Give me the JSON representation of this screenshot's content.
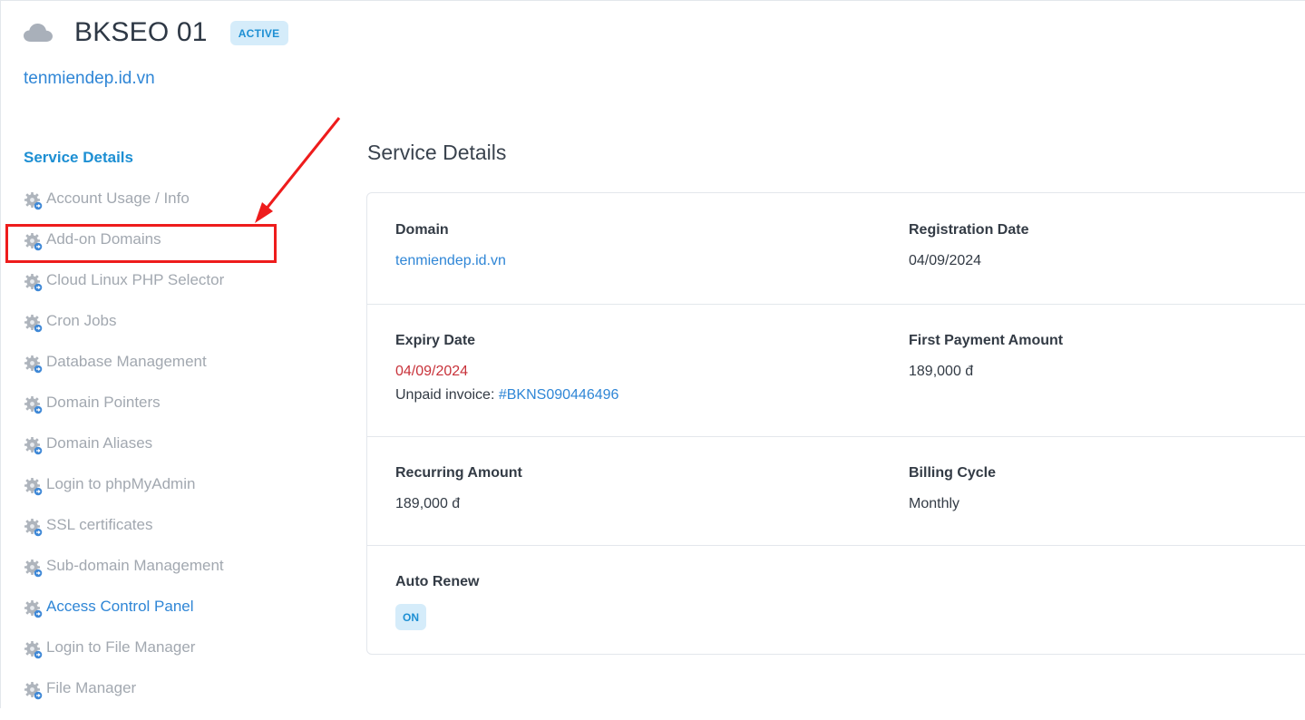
{
  "header": {
    "icon": "cloud-icon",
    "service_name": "BKSEO 01",
    "status": "ACTIVE",
    "domain": "tenmiendep.id.vn"
  },
  "sidebar": {
    "heading": "Service Details",
    "item_icon": "gear-icon",
    "items": [
      {
        "label": "Account Usage / Info"
      },
      {
        "label": "Add-on Domains"
      },
      {
        "label": "Cloud Linux PHP Selector"
      },
      {
        "label": "Cron Jobs"
      },
      {
        "label": "Database Management"
      },
      {
        "label": "Domain Pointers"
      },
      {
        "label": "Domain Aliases"
      },
      {
        "label": "Login to phpMyAdmin"
      },
      {
        "label": "SSL certificates"
      },
      {
        "label": "Sub-domain Management"
      },
      {
        "label": "Access Control Panel"
      },
      {
        "label": "Login to File Manager"
      },
      {
        "label": "File Manager"
      }
    ],
    "highlighted_item": "Add-on Domains"
  },
  "main": {
    "title": "Service Details",
    "domain_label": "Domain",
    "domain_value": "tenmiendep.id.vn",
    "registration_label": "Registration Date",
    "registration_value": "04/09/2024",
    "expiry_label": "Expiry Date",
    "expiry_value": "04/09/2024",
    "unpaid_text": "Unpaid invoice:",
    "unpaid_invoice": "#BKNS090446496",
    "first_payment_label": "First Payment Amount",
    "first_payment_value": "189,000 đ",
    "recurring_label": "Recurring Amount",
    "recurring_value": "189,000 đ",
    "billing_cycle_label": "Billing Cycle",
    "billing_cycle_value": "Monthly",
    "auto_renew_label": "Auto Renew",
    "auto_renew_value": "ON"
  },
  "colors": {
    "accent": "#1d8fd3",
    "link": "#2f86d6",
    "danger": "#c8323a",
    "annotation": "#ee1c1c"
  }
}
